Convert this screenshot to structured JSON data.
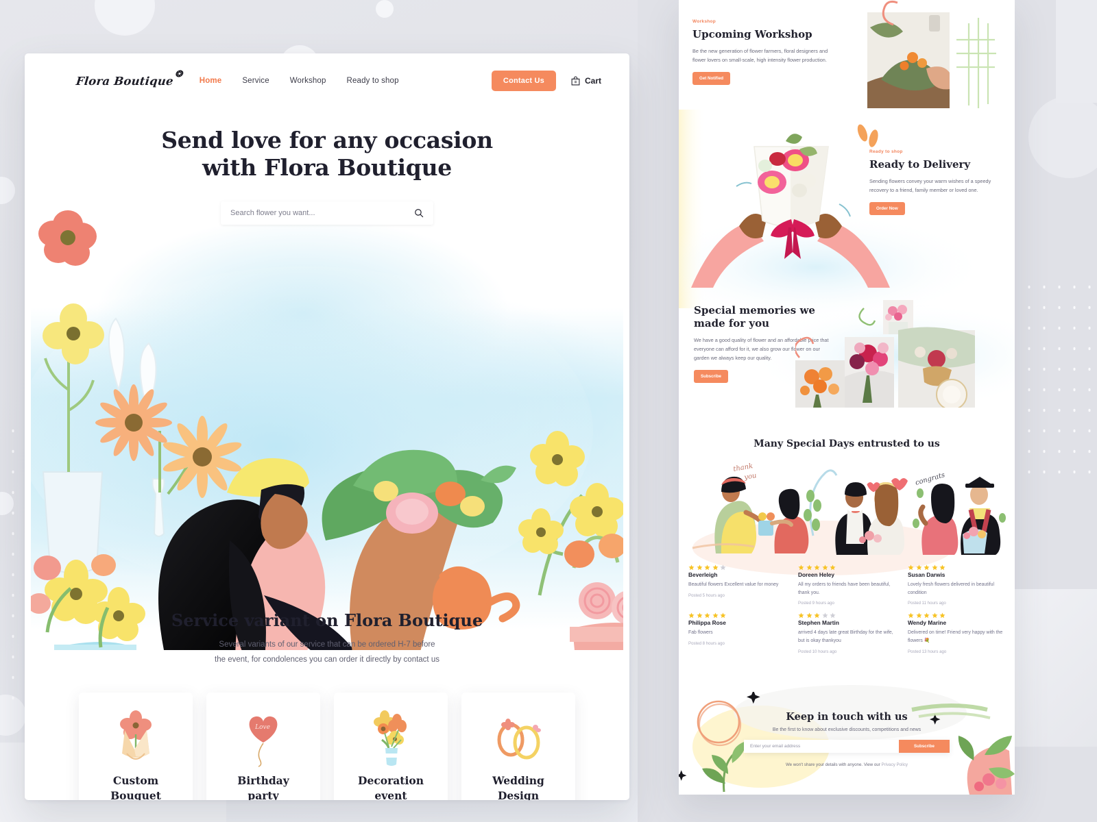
{
  "brand": {
    "name": "Flora Boutique",
    "accent": "#f58a5e",
    "dark": "#20202e"
  },
  "nav": {
    "links": [
      {
        "label": "Home",
        "active": true
      },
      {
        "label": "Service",
        "active": false
      },
      {
        "label": "Workshop",
        "active": false
      },
      {
        "label": "Ready to shop",
        "active": false
      }
    ],
    "contact_label": "Contact Us",
    "cart_label": "Cart"
  },
  "hero": {
    "title_line1": "Send love for any occasion",
    "title_line2": "with Flora Boutique",
    "search_placeholder": "Search flower you want...",
    "search_value": ""
  },
  "service": {
    "heading": "Service variant on Flora Boutique",
    "sub_line1": "Several variants of our service that can be ordered H-7 before",
    "sub_line2": "the event, for condolences you can order it directly by contact us",
    "cards": [
      {
        "label_line1": "Custom",
        "label_line2": "Bouquet",
        "icon": "bouquet-icon"
      },
      {
        "label_line1": "Birthday",
        "label_line2": "party",
        "icon": "heart-balloon-icon"
      },
      {
        "label_line1": "Decoration",
        "label_line2": "event",
        "icon": "flower-vase-icon"
      },
      {
        "label_line1": "Wedding",
        "label_line2": "Design",
        "icon": "wedding-rings-icon"
      }
    ]
  },
  "workshop": {
    "eyebrow": "Workshop",
    "heading": "Upcoming Workshop",
    "body": "Be the new generation of flower farmers, floral designers and flower lovers on small-scale, high intensity flower production.",
    "button": "Get Notified"
  },
  "delivery": {
    "eyebrow": "Ready to shop",
    "heading": "Ready to Delivery",
    "body": "Sending flowers convey your warm wishes of a speedy recovery to a friend, family member or loved one.",
    "button": "Order Now"
  },
  "memories": {
    "heading": "Special memories we made for you",
    "body": "We have a good quality of flower and an affordable price that everyone can afford for it, we also grow our flower on our garden we always keep our quality.",
    "button": "Subscribe"
  },
  "special_days": {
    "heading": "Many Special Days entrusted to us"
  },
  "reviews": [
    {
      "name": "Beverleigh",
      "rating": 4,
      "text": "Beautiful flowers Excellent value for money",
      "time": "Posted 5 hours ago"
    },
    {
      "name": "Doreen Heley",
      "rating": 5,
      "text": "All my orders to friends have been beautiful, thank you.",
      "time": "Posted 9 hours ago"
    },
    {
      "name": "Susan Darwis",
      "rating": 5,
      "text": "Lovely fresh flowers delivered in beautiful condition",
      "time": "Posted 11 hours ago"
    },
    {
      "name": "Philippa Rose",
      "rating": 5,
      "text": "Fab flowers",
      "time": "Posted 8 hours ago"
    },
    {
      "name": "Stephen Martin",
      "rating": 3,
      "text": "arrived 4 days late  great Birthday for the wife, but is okay thankyou",
      "time": "Posted 10 hours ago"
    },
    {
      "name": "Wendy Marine",
      "rating": 5,
      "text": "Delivered  on time! Friend  very happy with  the  flowers 💐",
      "time": "Posted 13 hours ago"
    }
  ],
  "newsletter": {
    "heading": "Keep in touch with us",
    "sub": "Be the first to know about exclusive discounts, competitions and news",
    "placeholder": "Enter your email address",
    "value": "",
    "button": "Subscribe",
    "note_prefix": "We won't share your details with anyone. View our ",
    "note_link": "Privacy Policy"
  },
  "illustration_captions": {
    "thank_you": "thank you",
    "congrats": "congrats"
  }
}
